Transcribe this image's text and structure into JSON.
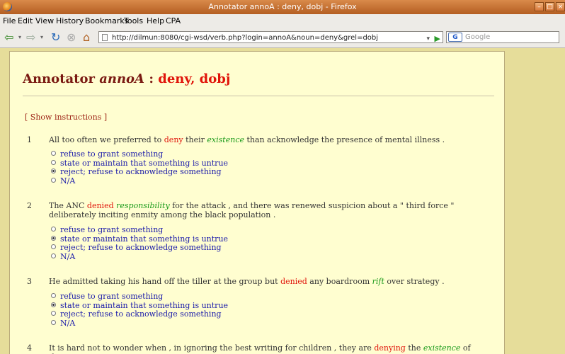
{
  "window": {
    "title": "Annotator annoA : deny, dobj - Firefox"
  },
  "menu": [
    "File",
    "Edit",
    "View",
    "History",
    "Bookmarks",
    "Tools",
    "Help",
    "CPA"
  ],
  "toolbar": {
    "url": "http://dilmun:8080/cgi-wsd/verb.php?login=annoA&noun=deny&grel=dobj",
    "search_engine": "G",
    "search_placeholder": "Google"
  },
  "page": {
    "heading_prefix": "Annotator",
    "annotator": "annoA",
    "separator": ":",
    "verb_rel": "deny, dobj",
    "instructions_link": "[ Show instructions ]"
  },
  "items": [
    {
      "num": "1",
      "pre": "All too often we preferred to ",
      "target": "deny",
      "mid": " their ",
      "arg": "existence",
      "post": " than acknowledge the presence of mental illness .",
      "options": [
        {
          "label": "refuse to grant something",
          "selected": false
        },
        {
          "label": "state or maintain that something is untrue",
          "selected": false
        },
        {
          "label": "reject; refuse to acknowledge something",
          "selected": true
        },
        {
          "label": "N/A",
          "selected": false
        }
      ]
    },
    {
      "num": "2",
      "pre": "The ANC ",
      "target": "denied",
      "mid": " ",
      "arg": "responsibility",
      "post": " for the attack , and there was renewed suspicion about a \" third force \" deliberately inciting enmity among the black population .",
      "options": [
        {
          "label": "refuse to grant something",
          "selected": false
        },
        {
          "label": "state or maintain that something is untrue",
          "selected": true
        },
        {
          "label": "reject; refuse to acknowledge something",
          "selected": false
        },
        {
          "label": "N/A",
          "selected": false
        }
      ]
    },
    {
      "num": "3",
      "pre": "He admitted taking his hand off the tiller at the group but ",
      "target": "denied",
      "mid": " any boardroom ",
      "arg": "rift",
      "post": " over strategy .",
      "options": [
        {
          "label": "refuse to grant something",
          "selected": false
        },
        {
          "label": "state or maintain that something is untrue",
          "selected": true
        },
        {
          "label": "reject; refuse to acknowledge something",
          "selected": false
        },
        {
          "label": "N/A",
          "selected": false
        }
      ]
    },
    {
      "num": "4",
      "pre": "It is hard not to wonder when , in ignoring the best writing for children , they are ",
      "target": "denying",
      "mid": " the ",
      "arg": "existence",
      "post": " of the",
      "options": []
    }
  ]
}
